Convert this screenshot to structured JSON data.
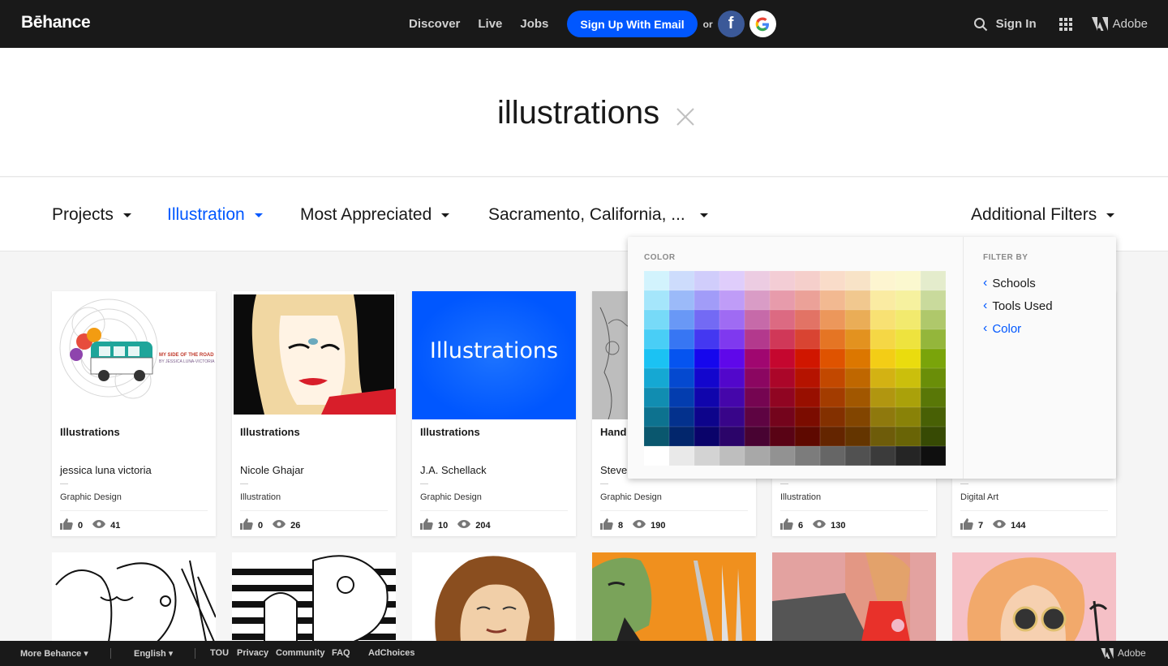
{
  "nav": {
    "logo": "Bēhance",
    "links": [
      "Discover",
      "Live",
      "Jobs"
    ],
    "signup": "Sign Up With Email",
    "or": "or",
    "signin": "Sign In",
    "adobe": "Adobe"
  },
  "search": {
    "term": "illustrations"
  },
  "filters": [
    {
      "label": "Projects",
      "active": false
    },
    {
      "label": "Illustration",
      "active": true
    },
    {
      "label": "Most Appreciated",
      "active": false
    },
    {
      "label": "Sacramento, California, ...",
      "active": false
    },
    {
      "label": "Additional Filters",
      "active": false
    }
  ],
  "dropdown": {
    "color_label": "COLOR",
    "filter_by_label": "FILTER BY",
    "items": [
      "Schools",
      "Tools Used",
      "Color"
    ],
    "palette": [
      [
        "#d2f3fd",
        "#cddcfc",
        "#d0cdfb",
        "#dfcdfb",
        "#eccce2",
        "#f3cdd5",
        "#f5cfcb",
        "#f9dcc9",
        "#f8e3c7",
        "#fdf5d0",
        "#fbf8cf",
        "#e4eccc"
      ],
      [
        "#a5e6fb",
        "#9bbaf9",
        "#a19cf8",
        "#bf9cf7",
        "#d99cc6",
        "#e79bab",
        "#eba198",
        "#f2b991",
        "#f1c88f",
        "#faeba2",
        "#f6f19f",
        "#c9da9c"
      ],
      [
        "#77daf8",
        "#6998f6",
        "#736af4",
        "#9f6bf3",
        "#c66aa9",
        "#dc6a82",
        "#e27365",
        "#ec975b",
        "#eaad57",
        "#f8e173",
        "#f2ea6e",
        "#afc86b"
      ],
      [
        "#49cef6",
        "#3776f3",
        "#4438f1",
        "#7f39ef",
        "#b3398d",
        "#d03858",
        "#d94432",
        "#e57524",
        "#e3921f",
        "#f5d745",
        "#eee33e",
        "#94b63b"
      ],
      [
        "#1bc2f3",
        "#0554f0",
        "#1607ed",
        "#5f08ea",
        "#a00770",
        "#c5072f",
        "#d01600",
        "#df5300",
        "#dc7700",
        "#f3cd16",
        "#eadc0e",
        "#7aa40a"
      ],
      [
        "#15a8d3",
        "#0449d0",
        "#1306cd",
        "#5207cb",
        "#8b0661",
        "#ab0629",
        "#b51300",
        "#c24800",
        "#bf6700",
        "#d3b213",
        "#cbbf0c",
        "#6a8e08"
      ],
      [
        "#118db1",
        "#033daf",
        "#1005ac",
        "#4506aa",
        "#750551",
        "#900522",
        "#980f00",
        "#a33c00",
        "#a15700",
        "#b19610",
        "#aaa10a",
        "#597707"
      ],
      [
        "#0d728f",
        "#03318d",
        "#0d048b",
        "#380589",
        "#5e0442",
        "#74041c",
        "#7b0c00",
        "#833000",
        "#824500",
        "#8f790d",
        "#898208",
        "#486005"
      ],
      [
        "#0a576e",
        "#02266c",
        "#0a036a",
        "#2b0469",
        "#480332",
        "#590315",
        "#5e0900",
        "#642500",
        "#643500",
        "#6e5c0a",
        "#696406",
        "#374a04"
      ],
      [
        "#ffffff",
        "#e9e9e9",
        "#d3d3d3",
        "#bebebe",
        "#a8a8a8",
        "#929292",
        "#7c7c7c",
        "#666666",
        "#515151",
        "#3b3b3b",
        "#252525",
        "#0f0f0f"
      ]
    ]
  },
  "cards": [
    {
      "title": "Illustrations",
      "owner": "jessica luna victoria",
      "field": "Graphic Design",
      "likes": "0",
      "views": "41",
      "thumb_text": ""
    },
    {
      "title": "Illustrations",
      "owner": "Nicole Ghajar",
      "field": "Illustration",
      "likes": "0",
      "views": "26",
      "thumb_text": ""
    },
    {
      "title": "Illustrations",
      "owner": "J.A. Schellack",
      "field": "Graphic Design",
      "likes": "10",
      "views": "204",
      "thumb_text": "Illustrations"
    },
    {
      "title": "Hand",
      "owner": "Steve",
      "field": "Graphic Design",
      "likes": "8",
      "views": "190",
      "thumb_text": ""
    },
    {
      "title": "",
      "owner": "",
      "field": "Illustration",
      "likes": "6",
      "views": "130",
      "thumb_text": ""
    },
    {
      "title": "",
      "owner": "",
      "field": "Digital Art",
      "likes": "7",
      "views": "144",
      "thumb_text": ""
    }
  ],
  "card1_thumb_caption": "MY SIDE OF THE ROAD",
  "card1_thumb_byline": "BY JESSICA LUNA-VICTORIA",
  "footer": {
    "more": "More Behance",
    "lang": "English",
    "links": [
      "TOU",
      "Privacy",
      "Community",
      "FAQ"
    ],
    "adchoices": "AdChoices",
    "adobe": "Adobe"
  }
}
